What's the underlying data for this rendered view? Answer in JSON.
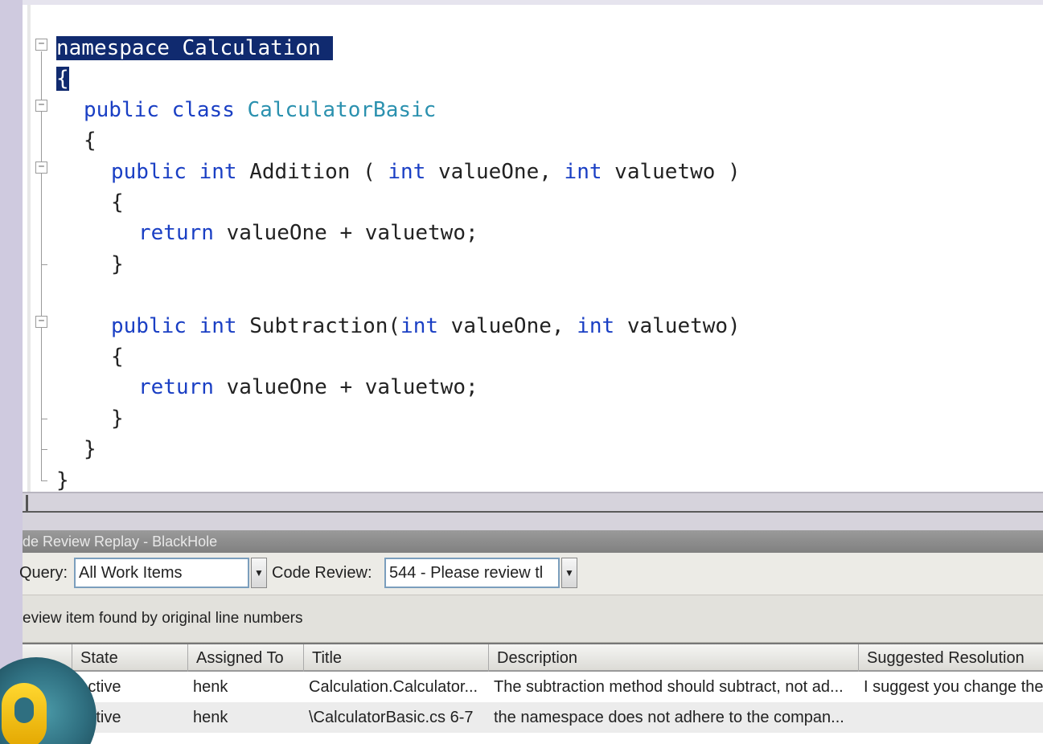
{
  "editor": {
    "lines": [
      {
        "indent": 0,
        "tokens": [
          {
            "t": "namespace Calculation ",
            "c": "sel"
          }
        ]
      },
      {
        "indent": 0,
        "tokens": [
          {
            "t": "{",
            "c": "sel"
          }
        ]
      },
      {
        "indent": 2,
        "tokens": [
          {
            "t": "public",
            "c": "kw"
          },
          {
            "t": " "
          },
          {
            "t": "class",
            "c": "kw"
          },
          {
            "t": " "
          },
          {
            "t": "CalculatorBasic",
            "c": "ty"
          }
        ]
      },
      {
        "indent": 2,
        "tokens": [
          {
            "t": "{"
          }
        ]
      },
      {
        "indent": 4,
        "tokens": [
          {
            "t": "public",
            "c": "kw"
          },
          {
            "t": " "
          },
          {
            "t": "int",
            "c": "kw"
          },
          {
            "t": " Addition ( "
          },
          {
            "t": "int",
            "c": "kw"
          },
          {
            "t": " valueOne, "
          },
          {
            "t": "int",
            "c": "kw"
          },
          {
            "t": " valuetwo )"
          }
        ]
      },
      {
        "indent": 4,
        "tokens": [
          {
            "t": "{"
          }
        ]
      },
      {
        "indent": 6,
        "tokens": [
          {
            "t": "return",
            "c": "kw"
          },
          {
            "t": " valueOne + valuetwo;"
          }
        ]
      },
      {
        "indent": 4,
        "tokens": [
          {
            "t": "}"
          }
        ]
      },
      {
        "indent": 0,
        "tokens": []
      },
      {
        "indent": 4,
        "tokens": [
          {
            "t": "public",
            "c": "kw"
          },
          {
            "t": " "
          },
          {
            "t": "int",
            "c": "kw"
          },
          {
            "t": " Subtraction("
          },
          {
            "t": "int",
            "c": "kw"
          },
          {
            "t": " valueOne, "
          },
          {
            "t": "int",
            "c": "kw"
          },
          {
            "t": " valuetwo)"
          }
        ]
      },
      {
        "indent": 4,
        "tokens": [
          {
            "t": "{"
          }
        ]
      },
      {
        "indent": 6,
        "tokens": [
          {
            "t": "return",
            "c": "kw"
          },
          {
            "t": " valueOne + valuetwo;"
          }
        ]
      },
      {
        "indent": 4,
        "tokens": [
          {
            "t": "}"
          }
        ]
      },
      {
        "indent": 2,
        "tokens": [
          {
            "t": "}"
          }
        ]
      },
      {
        "indent": 0,
        "tokens": [
          {
            "t": "}"
          }
        ]
      }
    ]
  },
  "panel": {
    "title": "de Review Replay - BlackHole",
    "query_label": "Query:",
    "query_value": "All Work Items",
    "code_review_label": "Code Review:",
    "code_review_value": "544 - Please review tl",
    "info_text": "eview item found by original line numbers"
  },
  "grid": {
    "columns": [
      "",
      "State",
      "Assigned To",
      "Title",
      "Description",
      "Suggested Resolution"
    ],
    "rows": [
      [
        "",
        "Active",
        "henk",
        "Calculation.Calculator...",
        "The subtraction method should subtract, not ad...",
        "I suggest you change the"
      ],
      [
        "",
        "Active",
        "henk",
        "\\CalculatorBasic.cs 6-7",
        "the namespace does not adhere to the compan...",
        ""
      ]
    ]
  },
  "colors": {
    "keyword": "#1a3fc4",
    "type": "#2b91af",
    "selection": "#102a6f"
  },
  "icons": {
    "fold_collapse": "minus-box-icon",
    "dropdown": "chevron-down-icon",
    "logo": "logo-icon"
  }
}
